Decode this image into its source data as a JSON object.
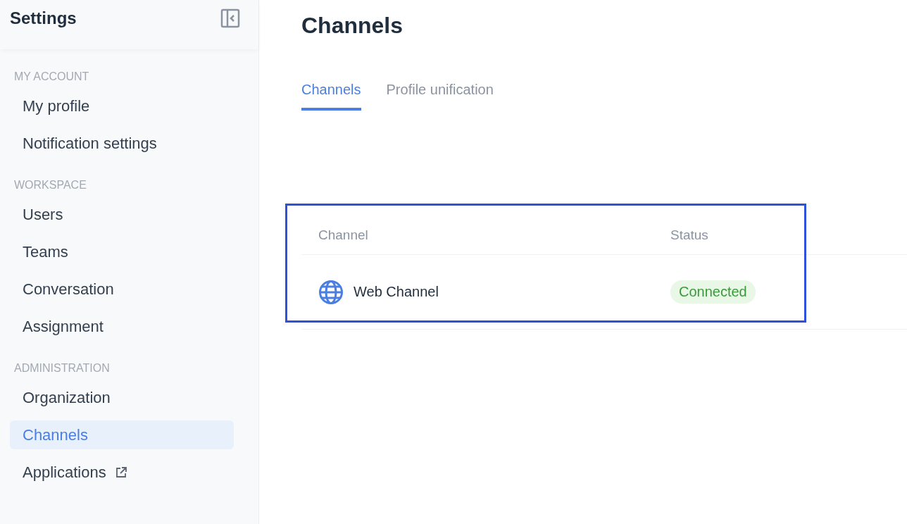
{
  "sidebar": {
    "title": "Settings",
    "sections": [
      {
        "heading": "MY ACCOUNT",
        "items": [
          {
            "label": "My profile",
            "selected": false,
            "external": false
          },
          {
            "label": "Notification settings",
            "selected": false,
            "external": false
          }
        ]
      },
      {
        "heading": "WORKSPACE",
        "items": [
          {
            "label": "Users",
            "selected": false,
            "external": false
          },
          {
            "label": "Teams",
            "selected": false,
            "external": false
          },
          {
            "label": "Conversation",
            "selected": false,
            "external": false
          },
          {
            "label": "Assignment",
            "selected": false,
            "external": false
          }
        ]
      },
      {
        "heading": "ADMINISTRATION",
        "items": [
          {
            "label": "Organization",
            "selected": false,
            "external": false
          },
          {
            "label": "Channels",
            "selected": true,
            "external": false
          },
          {
            "label": "Applications",
            "selected": false,
            "external": true
          }
        ]
      }
    ]
  },
  "page": {
    "title": "Channels",
    "tabs": [
      {
        "label": "Channels",
        "selected": true
      },
      {
        "label": "Profile unification",
        "selected": false
      }
    ],
    "table": {
      "columns": [
        "Channel",
        "Status"
      ],
      "rows": [
        {
          "channel": "Web Channel",
          "status": "Connected"
        }
      ]
    }
  }
}
